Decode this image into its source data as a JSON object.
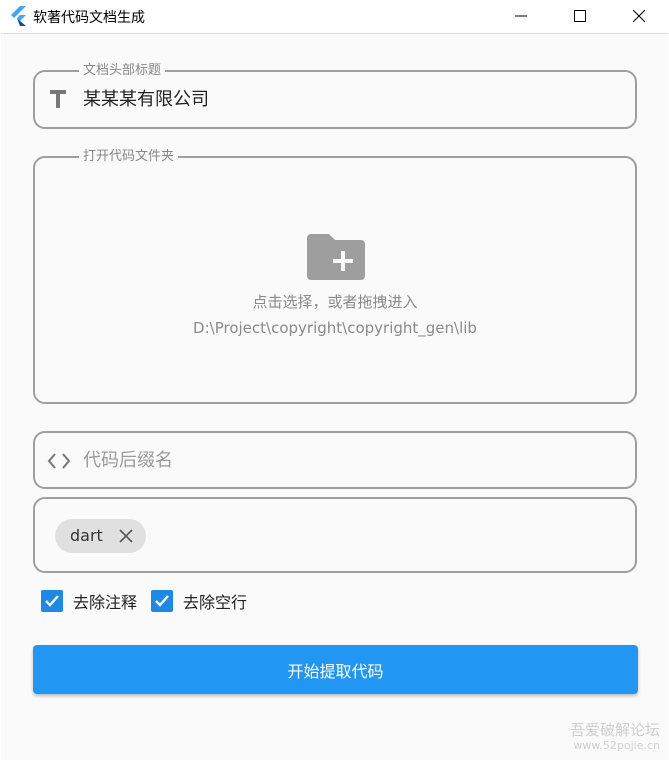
{
  "window": {
    "title": "软著代码文档生成",
    "minimize_icon": "minimize-icon",
    "maximize_icon": "maximize-icon",
    "close_icon": "close-icon"
  },
  "title_field": {
    "legend": "文档头部标题",
    "value": "某某某有限公司",
    "icon": "text-icon"
  },
  "folder_field": {
    "legend": "打开代码文件夹",
    "hint": "点击选择，或者拖拽进入",
    "path": "D:\\Project\\copyright\\copyright_gen\\lib",
    "icon": "folder-add-icon"
  },
  "suffix_field": {
    "placeholder": "代码后缀名",
    "value": "",
    "icon": "code-icon"
  },
  "chips": [
    {
      "label": "dart"
    }
  ],
  "options": {
    "remove_comments": {
      "label": "去除注释",
      "checked": true
    },
    "remove_blank_lines": {
      "label": "去除空行",
      "checked": true
    }
  },
  "actions": {
    "start_label": "开始提取代码"
  },
  "watermark": {
    "text": "吾爱破解论坛",
    "url": "www.52pojie.cn"
  },
  "colors": {
    "accent": "#2196f3",
    "checkbox": "#1e88e5",
    "border": "#9e9e9e",
    "background": "#fafafa"
  }
}
